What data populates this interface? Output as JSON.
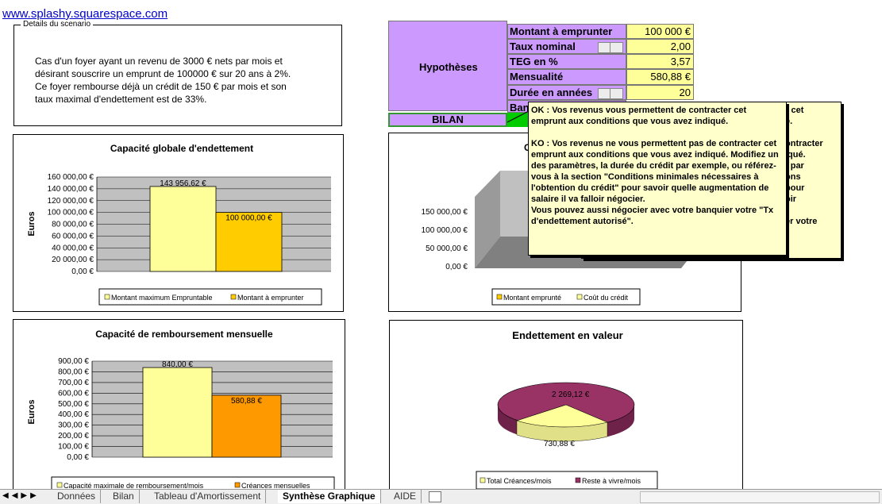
{
  "link": "www.splashy.squarespace.com",
  "scenario": {
    "title": "Details du scenario",
    "text1": "Cas d'un foyer ayant un revenu de 3000 € nets par mois et",
    "text2": "désirant souscrire un emprunt de 100000 € sur 20 ans à 2%.",
    "text3": "Ce foyer rembourse déjà un crédit de 150 € par mois et son",
    "text4": "taux maximal d'endettement est de 33%."
  },
  "hypotheses": {
    "title": "Hypothèses",
    "rows": [
      {
        "label": "Montant à emprunter",
        "value": "100 000 €"
      },
      {
        "label": "Taux nominal",
        "value": "2,00"
      },
      {
        "label": "TEG en %",
        "value": "3,57"
      },
      {
        "label": "Mensualité",
        "value": "580,88 €"
      },
      {
        "label": "Durée en années",
        "value": "20"
      },
      {
        "label": "Ban",
        "value": ""
      }
    ],
    "bilan": "BILAN"
  },
  "colors": {
    "purple": "#cc99ff",
    "yellow_cell": "#ffff99",
    "bar_pale": "#ffff99",
    "bar_orange": "#ffcc00",
    "bar_dark_orange": "#ff9900",
    "chart_bg": "#c0c0c0",
    "pie_maroon": "#993366",
    "green": "#00cc00"
  },
  "popup_back": {
    "lines": [
      "er cet",
      "é.",
      "ontracter",
      "iqué.",
      "t par",
      "ons",
      "pour",
      "oir",
      "er votre"
    ]
  },
  "popup": {
    "ok": "OK : Vos revenus vous permettent de contracter cet emprunt aux conditions que vous avez indiqué.",
    "ko": "KO :  Vos revenus ne vous permettent pas de contracter cet emprunt aux conditions que vous avez indiqué. Modifiez un des paramètres, la durée du crédit par exemple, ou référez-vous à la section \"Conditions minimales nécessaires à l'obtention du crédit\" pour savoir quelle augmentation de salaire il va falloir négocier.",
    "extra": "Vous pouvez aussi négocier avec votre banquier votre \"Tx d'endettement autorisé\"."
  },
  "chart_data": [
    {
      "type": "bar",
      "title": "Capacité  globale  d'endettement",
      "ylabel": "Euros",
      "ylim": [
        0,
        160000
      ],
      "yticks": [
        "0,00 €",
        "20 000,00 €",
        "40 000,00 €",
        "60 000,00 €",
        "80 000,00 €",
        "100 000,00 €",
        "120 000,00 €",
        "140 000,00 €",
        "160 000,00 €"
      ],
      "series": [
        {
          "name": "Montant maximum Empruntable",
          "values": [
            143956.62
          ],
          "label": "143 956,62 €"
        },
        {
          "name": "Montant à emprunter",
          "values": [
            100000
          ],
          "label": "100 000,00 €"
        }
      ]
    },
    {
      "type": "bar",
      "title": "Capacité  de remboursement mensuelle",
      "ylabel": "Euros",
      "ylim": [
        0,
        900
      ],
      "yticks": [
        "0,00 €",
        "100,00 €",
        "200,00 €",
        "300,00 €",
        "400,00 €",
        "500,00 €",
        "600,00 €",
        "700,00 €",
        "800,00 €",
        "900,00 €"
      ],
      "series": [
        {
          "name": "Capacité maximale de remboursement/mois",
          "values": [
            840
          ],
          "label": "840,00 €"
        },
        {
          "name": "Créances mensuelles",
          "values": [
            580.88
          ],
          "label": "580,88 €"
        }
      ]
    },
    {
      "type": "area",
      "title": "C",
      "yticks": [
        "0,00 €",
        "50 000,00 €",
        "100 000,00 €",
        "150 000,00 €"
      ],
      "series": [
        {
          "name": "Montant emprunté"
        },
        {
          "name": "Coût du crédit"
        }
      ]
    },
    {
      "type": "pie",
      "title": "Endettement en valeur",
      "series": [
        {
          "name": "Total Créances/mois",
          "value": 730.88,
          "label": "730,88 €"
        },
        {
          "name": "Reste à vivre/mois",
          "value": 2269.12,
          "label": "2 269,12 €"
        }
      ]
    }
  ],
  "tabs": [
    "Données",
    "Bilan",
    "Tableau d'Amortissement",
    "Synthèse Graphique",
    "AIDE"
  ]
}
